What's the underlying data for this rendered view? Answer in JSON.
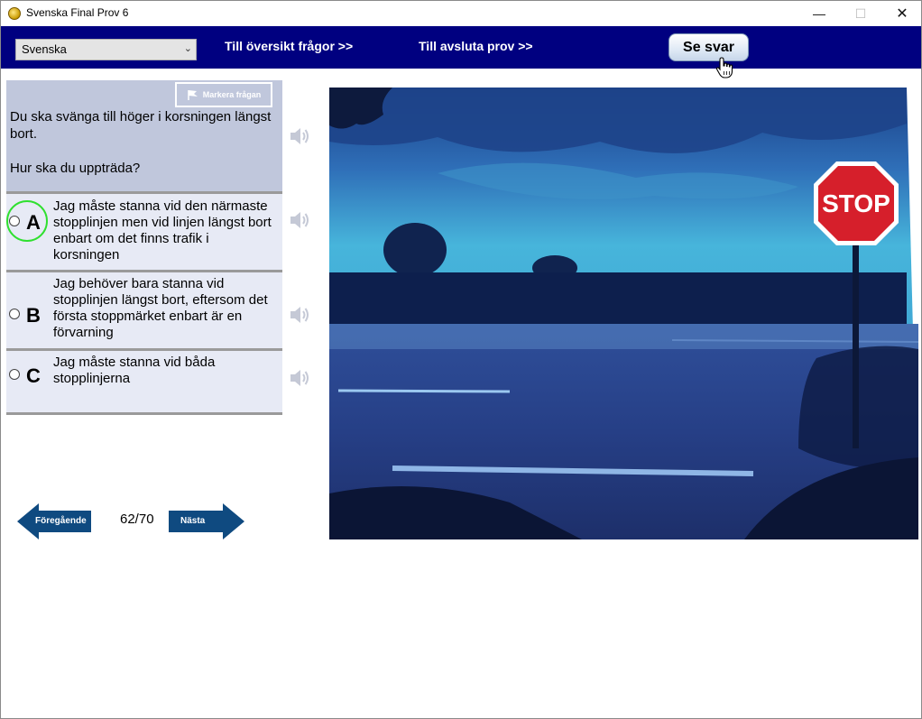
{
  "window": {
    "title": "Svenska Final Prov 6",
    "minimize": "—",
    "maximize": "☐",
    "close": "✕"
  },
  "navbar": {
    "language": "Svenska",
    "overview_link": "Till översikt frågor >>",
    "finish_link": "Till avsluta prov  >>",
    "see_answer": "Se svar"
  },
  "question": {
    "flag_label": "Markera frågan",
    "text": "Du ska svänga till höger i korsningen längst bort.\n\nHur ska du uppträda?"
  },
  "answers": [
    {
      "letter": "A",
      "text": "Jag måste stanna vid den närmaste stopplinjen men vid linjen längst bort enbart om det finns trafik i korsningen",
      "highlighted": true
    },
    {
      "letter": "B",
      "text": "Jag behöver bara stanna vid stopplinjen längst bort, eftersom det första stoppmärket enbart är en förvarning",
      "highlighted": false
    },
    {
      "letter": "C",
      "text": "Jag måste stanna vid båda stopplinjerna",
      "highlighted": false
    }
  ],
  "navigation": {
    "previous": "Föregående",
    "next": "Nästa",
    "counter": "62/70"
  },
  "photo": {
    "sign_text": "STOP"
  },
  "colors": {
    "navbar": "#000080",
    "question_bg": "#c0c7dc",
    "answer_bg": "#e7eaf5",
    "arrow": "#0f4a80",
    "highlight_ring": "#2fe02f"
  }
}
